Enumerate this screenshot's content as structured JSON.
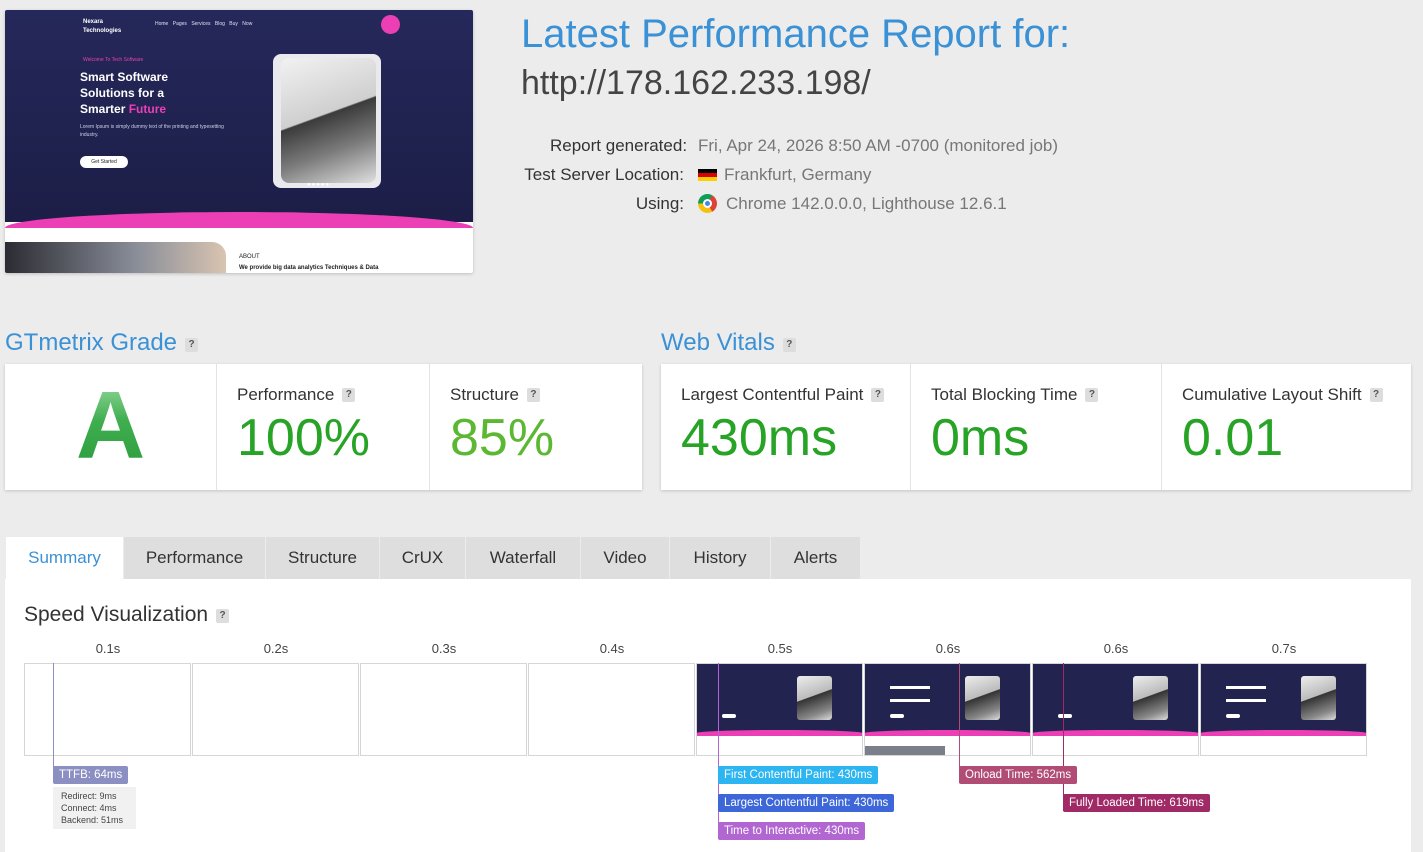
{
  "screenshot": {
    "brand": [
      "Nexara",
      "Technologies"
    ],
    "nav": [
      "Home",
      "Pages",
      "Services",
      "Blog",
      "Buy Now"
    ],
    "welcome": "Welcome To Tech Software",
    "hero_title": [
      "Smart Software",
      "Solutions for a",
      "Smarter"
    ],
    "hero_title_accent": "Future",
    "hero_text": "Lorem Ipsum is simply dummy text of the printing and typesetting industry.",
    "hero_button": "Get Started",
    "carousel_dots": "●●●●●",
    "about_label": "ABOUT",
    "about_text": "We provide big data analytics Techniques & Data"
  },
  "report": {
    "title": "Latest Performance Report for:",
    "url": "http://178.162.233.198/",
    "generated_label": "Report generated:",
    "generated_value": "Fri, Apr 24, 2026 8:50 AM -0700 (monitored job)",
    "location_label": "Test Server Location:",
    "location_value": "Frankfurt, Germany",
    "using_label": "Using:",
    "using_value": "Chrome 142.0.0.0, Lighthouse 12.6.1"
  },
  "grade": {
    "heading": "GTmetrix Grade",
    "letter": "A",
    "performance_label": "Performance",
    "performance_value": "100%",
    "structure_label": "Structure",
    "structure_value": "85%"
  },
  "vitals": {
    "heading": "Web Vitals",
    "lcp_label": "Largest Contentful Paint",
    "lcp_value": "430ms",
    "tbt_label": "Total Blocking Time",
    "tbt_value": "0ms",
    "cls_label": "Cumulative Layout Shift",
    "cls_value": "0.01"
  },
  "tabs": [
    "Summary",
    "Performance",
    "Structure",
    "CrUX",
    "Waterfall",
    "Video",
    "History",
    "Alerts"
  ],
  "active_tab": "Summary",
  "speed_visualization": {
    "title": "Speed Visualization",
    "time_labels": [
      "0.1s",
      "0.2s",
      "0.3s",
      "0.4s",
      "0.5s",
      "0.6s",
      "0.6s",
      "0.7s"
    ],
    "ttfb": "TTFB: 64ms",
    "ttfb_details": [
      "Redirect: 9ms",
      "Connect: 4ms",
      "Backend: 51ms"
    ],
    "fcp": "First Contentful Paint: 430ms",
    "lcp": "Largest Contentful Paint: 430ms",
    "tti": "Time to Interactive: 430ms",
    "onload": "Onload Time: 562ms",
    "fully_loaded": "Fully Loaded Time: 619ms"
  },
  "colors": {
    "accent_blue": "#3a91d6",
    "grade_green": "#27a326",
    "structure_green": "#5cb833",
    "ttfb": "#8c8fc2",
    "fcp": "#2cb5f0",
    "lcp": "#3d67d8",
    "tti": "#b266d1",
    "onload": "#b14d74",
    "fully_loaded": "#a02a66"
  }
}
